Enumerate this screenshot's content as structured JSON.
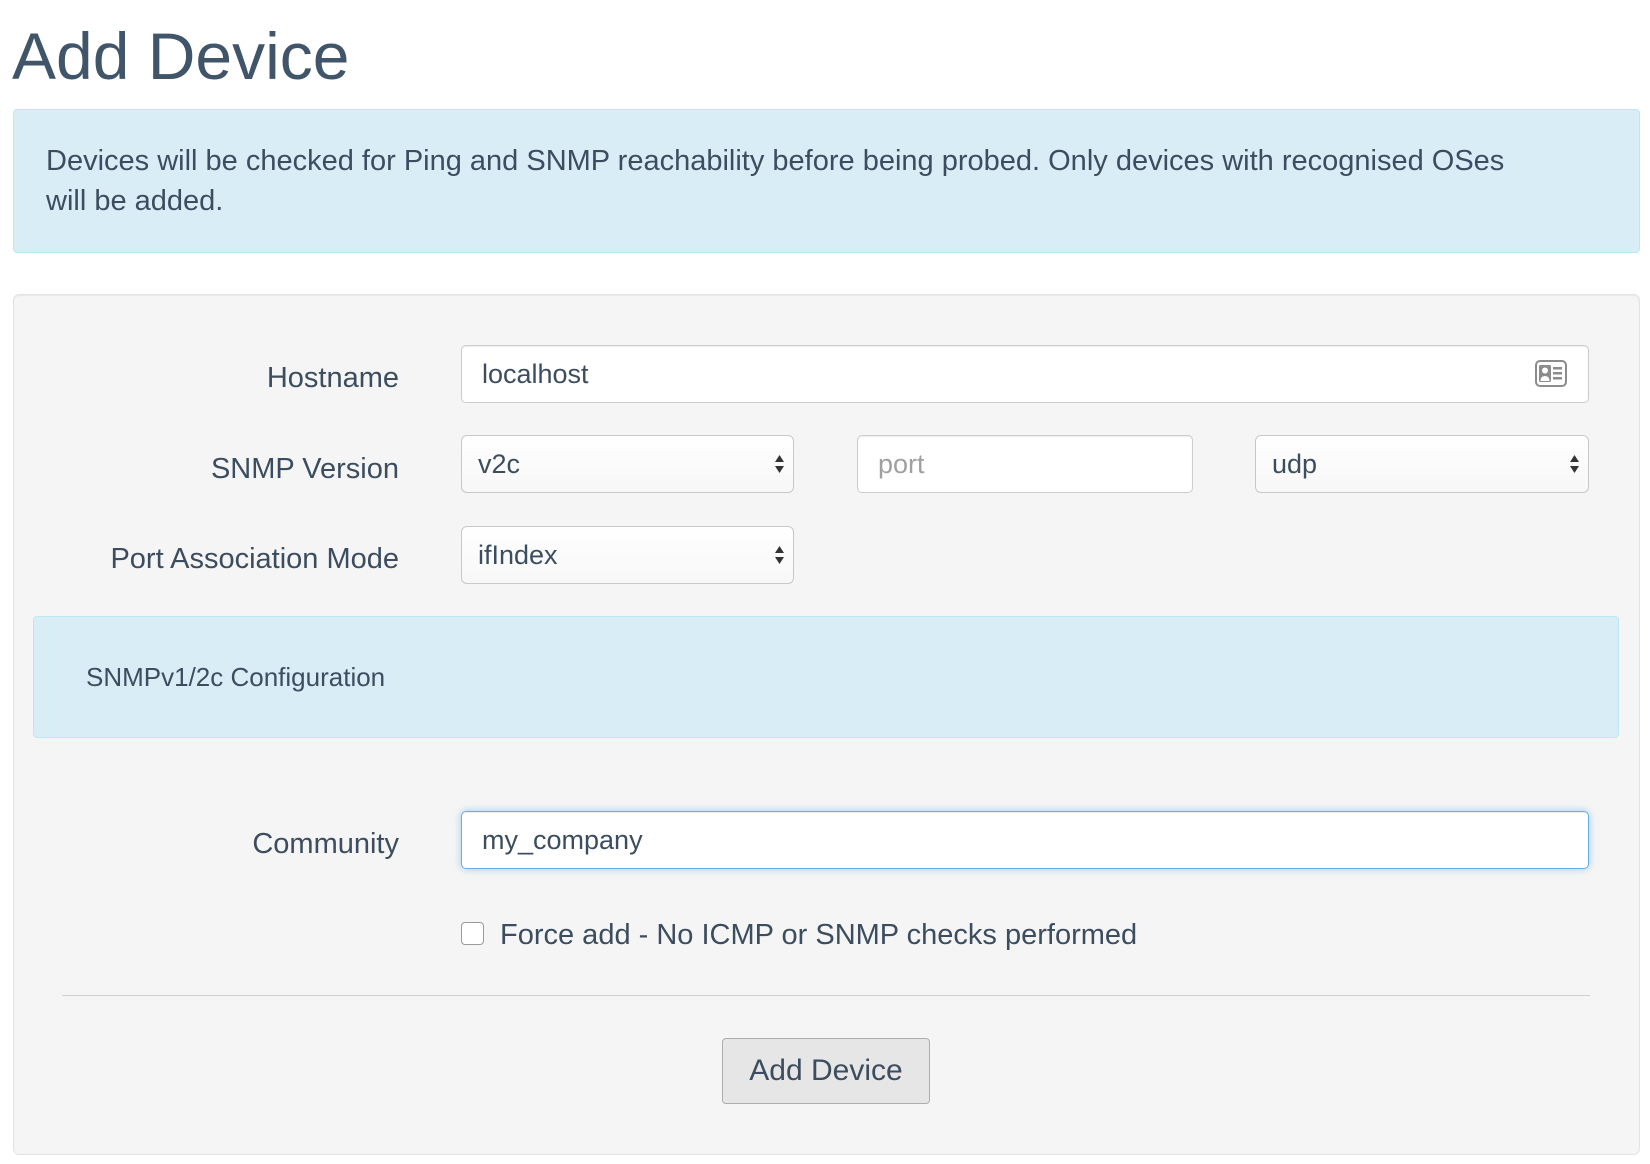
{
  "page": {
    "title": "Add Device"
  },
  "alert": {
    "text": "Devices will be checked for Ping and SNMP reachability before being probed. Only devices with recognised OSes will be added."
  },
  "form": {
    "hostname": {
      "label": "Hostname",
      "value": "localhost",
      "icon": "contact-card-icon"
    },
    "snmp_version": {
      "label": "SNMP Version",
      "selected": "v2c"
    },
    "port": {
      "placeholder": "port",
      "value": ""
    },
    "transport": {
      "selected": "udp"
    },
    "port_association": {
      "label": "Port Association Mode",
      "selected": "ifIndex"
    },
    "snmp_config": {
      "heading": "SNMPv1/2c Configuration"
    },
    "community": {
      "label": "Community",
      "value": "my_company",
      "focused": true
    },
    "force_add": {
      "label": "Force add - No ICMP or SNMP checks performed",
      "checked": false
    },
    "submit": {
      "label": "Add Device"
    }
  },
  "colors": {
    "title": "#405569",
    "text": "#3b4d5e",
    "alert_bg": "#d9edf7",
    "panel_bg": "#f5f5f5",
    "focus_border": "#66afe9"
  }
}
